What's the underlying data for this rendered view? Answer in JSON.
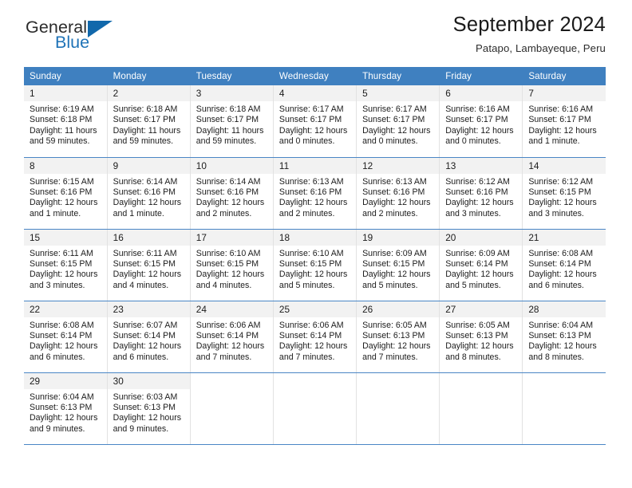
{
  "brand": {
    "name_part1": "General",
    "name_part2": "Blue",
    "logo_icon": "triangle-icon",
    "accent_color": "#1168ab"
  },
  "header": {
    "title": "September 2024",
    "subtitle": "Patapo, Lambayeque, Peru"
  },
  "theme": {
    "header_bar_color": "#3f80c0",
    "row_divider_color": "#4a86c5",
    "daynum_band_color": "#f2f2f2"
  },
  "calendar": {
    "weekday_headers": [
      "Sunday",
      "Monday",
      "Tuesday",
      "Wednesday",
      "Thursday",
      "Friday",
      "Saturday"
    ],
    "weeks": [
      [
        {
          "day": "1",
          "sunrise": "Sunrise: 6:19 AM",
          "sunset": "Sunset: 6:18 PM",
          "daylight_line1": "Daylight: 11 hours",
          "daylight_line2": "and 59 minutes."
        },
        {
          "day": "2",
          "sunrise": "Sunrise: 6:18 AM",
          "sunset": "Sunset: 6:17 PM",
          "daylight_line1": "Daylight: 11 hours",
          "daylight_line2": "and 59 minutes."
        },
        {
          "day": "3",
          "sunrise": "Sunrise: 6:18 AM",
          "sunset": "Sunset: 6:17 PM",
          "daylight_line1": "Daylight: 11 hours",
          "daylight_line2": "and 59 minutes."
        },
        {
          "day": "4",
          "sunrise": "Sunrise: 6:17 AM",
          "sunset": "Sunset: 6:17 PM",
          "daylight_line1": "Daylight: 12 hours",
          "daylight_line2": "and 0 minutes."
        },
        {
          "day": "5",
          "sunrise": "Sunrise: 6:17 AM",
          "sunset": "Sunset: 6:17 PM",
          "daylight_line1": "Daylight: 12 hours",
          "daylight_line2": "and 0 minutes."
        },
        {
          "day": "6",
          "sunrise": "Sunrise: 6:16 AM",
          "sunset": "Sunset: 6:17 PM",
          "daylight_line1": "Daylight: 12 hours",
          "daylight_line2": "and 0 minutes."
        },
        {
          "day": "7",
          "sunrise": "Sunrise: 6:16 AM",
          "sunset": "Sunset: 6:17 PM",
          "daylight_line1": "Daylight: 12 hours",
          "daylight_line2": "and 1 minute."
        }
      ],
      [
        {
          "day": "8",
          "sunrise": "Sunrise: 6:15 AM",
          "sunset": "Sunset: 6:16 PM",
          "daylight_line1": "Daylight: 12 hours",
          "daylight_line2": "and 1 minute."
        },
        {
          "day": "9",
          "sunrise": "Sunrise: 6:14 AM",
          "sunset": "Sunset: 6:16 PM",
          "daylight_line1": "Daylight: 12 hours",
          "daylight_line2": "and 1 minute."
        },
        {
          "day": "10",
          "sunrise": "Sunrise: 6:14 AM",
          "sunset": "Sunset: 6:16 PM",
          "daylight_line1": "Daylight: 12 hours",
          "daylight_line2": "and 2 minutes."
        },
        {
          "day": "11",
          "sunrise": "Sunrise: 6:13 AM",
          "sunset": "Sunset: 6:16 PM",
          "daylight_line1": "Daylight: 12 hours",
          "daylight_line2": "and 2 minutes."
        },
        {
          "day": "12",
          "sunrise": "Sunrise: 6:13 AM",
          "sunset": "Sunset: 6:16 PM",
          "daylight_line1": "Daylight: 12 hours",
          "daylight_line2": "and 2 minutes."
        },
        {
          "day": "13",
          "sunrise": "Sunrise: 6:12 AM",
          "sunset": "Sunset: 6:16 PM",
          "daylight_line1": "Daylight: 12 hours",
          "daylight_line2": "and 3 minutes."
        },
        {
          "day": "14",
          "sunrise": "Sunrise: 6:12 AM",
          "sunset": "Sunset: 6:15 PM",
          "daylight_line1": "Daylight: 12 hours",
          "daylight_line2": "and 3 minutes."
        }
      ],
      [
        {
          "day": "15",
          "sunrise": "Sunrise: 6:11 AM",
          "sunset": "Sunset: 6:15 PM",
          "daylight_line1": "Daylight: 12 hours",
          "daylight_line2": "and 3 minutes."
        },
        {
          "day": "16",
          "sunrise": "Sunrise: 6:11 AM",
          "sunset": "Sunset: 6:15 PM",
          "daylight_line1": "Daylight: 12 hours",
          "daylight_line2": "and 4 minutes."
        },
        {
          "day": "17",
          "sunrise": "Sunrise: 6:10 AM",
          "sunset": "Sunset: 6:15 PM",
          "daylight_line1": "Daylight: 12 hours",
          "daylight_line2": "and 4 minutes."
        },
        {
          "day": "18",
          "sunrise": "Sunrise: 6:10 AM",
          "sunset": "Sunset: 6:15 PM",
          "daylight_line1": "Daylight: 12 hours",
          "daylight_line2": "and 5 minutes."
        },
        {
          "day": "19",
          "sunrise": "Sunrise: 6:09 AM",
          "sunset": "Sunset: 6:15 PM",
          "daylight_line1": "Daylight: 12 hours",
          "daylight_line2": "and 5 minutes."
        },
        {
          "day": "20",
          "sunrise": "Sunrise: 6:09 AM",
          "sunset": "Sunset: 6:14 PM",
          "daylight_line1": "Daylight: 12 hours",
          "daylight_line2": "and 5 minutes."
        },
        {
          "day": "21",
          "sunrise": "Sunrise: 6:08 AM",
          "sunset": "Sunset: 6:14 PM",
          "daylight_line1": "Daylight: 12 hours",
          "daylight_line2": "and 6 minutes."
        }
      ],
      [
        {
          "day": "22",
          "sunrise": "Sunrise: 6:08 AM",
          "sunset": "Sunset: 6:14 PM",
          "daylight_line1": "Daylight: 12 hours",
          "daylight_line2": "and 6 minutes."
        },
        {
          "day": "23",
          "sunrise": "Sunrise: 6:07 AM",
          "sunset": "Sunset: 6:14 PM",
          "daylight_line1": "Daylight: 12 hours",
          "daylight_line2": "and 6 minutes."
        },
        {
          "day": "24",
          "sunrise": "Sunrise: 6:06 AM",
          "sunset": "Sunset: 6:14 PM",
          "daylight_line1": "Daylight: 12 hours",
          "daylight_line2": "and 7 minutes."
        },
        {
          "day": "25",
          "sunrise": "Sunrise: 6:06 AM",
          "sunset": "Sunset: 6:14 PM",
          "daylight_line1": "Daylight: 12 hours",
          "daylight_line2": "and 7 minutes."
        },
        {
          "day": "26",
          "sunrise": "Sunrise: 6:05 AM",
          "sunset": "Sunset: 6:13 PM",
          "daylight_line1": "Daylight: 12 hours",
          "daylight_line2": "and 7 minutes."
        },
        {
          "day": "27",
          "sunrise": "Sunrise: 6:05 AM",
          "sunset": "Sunset: 6:13 PM",
          "daylight_line1": "Daylight: 12 hours",
          "daylight_line2": "and 8 minutes."
        },
        {
          "day": "28",
          "sunrise": "Sunrise: 6:04 AM",
          "sunset": "Sunset: 6:13 PM",
          "daylight_line1": "Daylight: 12 hours",
          "daylight_line2": "and 8 minutes."
        }
      ],
      [
        {
          "day": "29",
          "sunrise": "Sunrise: 6:04 AM",
          "sunset": "Sunset: 6:13 PM",
          "daylight_line1": "Daylight: 12 hours",
          "daylight_line2": "and 9 minutes."
        },
        {
          "day": "30",
          "sunrise": "Sunrise: 6:03 AM",
          "sunset": "Sunset: 6:13 PM",
          "daylight_line1": "Daylight: 12 hours",
          "daylight_line2": "and 9 minutes."
        },
        null,
        null,
        null,
        null,
        null
      ]
    ]
  }
}
